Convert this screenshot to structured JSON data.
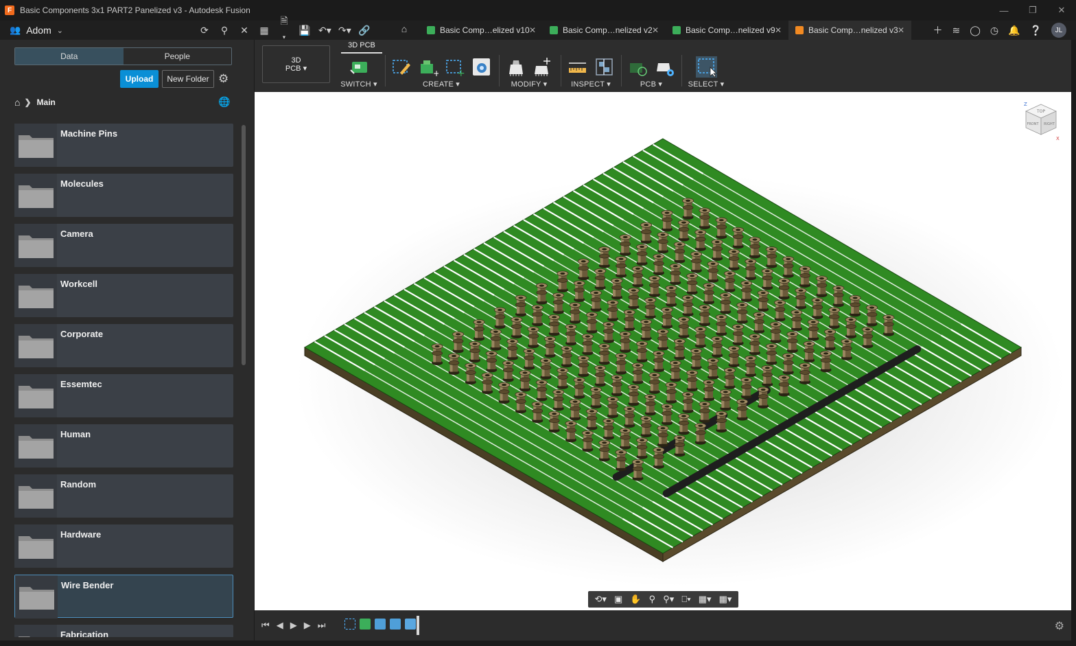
{
  "window": {
    "title": "Basic Components 3x1 PART2 Panelized v3 - Autodesk Fusion",
    "app_logo": "F",
    "controls": {
      "minimize": "—",
      "restore": "❐",
      "close": "✕"
    }
  },
  "topbar": {
    "team_name": "Adom",
    "tabs": [
      {
        "label": "Basic Comp…elized v10",
        "color": "#3cae5a",
        "active": false
      },
      {
        "label": "Basic Comp…nelized v2",
        "color": "#3cae5a",
        "active": false
      },
      {
        "label": "Basic Comp…nelized v9",
        "color": "#3cae5a",
        "active": false
      },
      {
        "label": "Basic Comp…nelized v3",
        "color": "#f28a22",
        "active": true
      }
    ],
    "avatar_initials": "JL"
  },
  "data_panel": {
    "tab_data": "Data",
    "tab_people": "People",
    "upload_label": "Upload",
    "new_folder_label": "New Folder",
    "breadcrumb": "Main",
    "folders": [
      {
        "name": "Machine Pins",
        "selected": false
      },
      {
        "name": "Molecules",
        "selected": false
      },
      {
        "name": "Camera",
        "selected": false
      },
      {
        "name": "Workcell",
        "selected": false
      },
      {
        "name": "Corporate",
        "selected": false
      },
      {
        "name": "Essemtec",
        "selected": false
      },
      {
        "name": "Human",
        "selected": false
      },
      {
        "name": "Random",
        "selected": false
      },
      {
        "name": "Hardware",
        "selected": false
      },
      {
        "name": "Wire Bender",
        "selected": true
      },
      {
        "name": "Fabrication",
        "selected": false
      }
    ]
  },
  "toolbar": {
    "workspace_line1": "3D",
    "workspace_line2": "PCB",
    "workspace_tab": "3D PCB",
    "groups": {
      "switch": "SWITCH",
      "create": "CREATE",
      "modify": "MODIFY",
      "inspect": "INSPECT",
      "pcb": "PCB",
      "select": "SELECT"
    }
  },
  "viewcube": {
    "face_top": "TOP",
    "face_front": "FRONT",
    "face_right": "RIGHT",
    "axis_z": "Z",
    "axis_x": "X"
  },
  "colors": {
    "board_green": "#2f8a22",
    "board_edge": "#5a4a2c",
    "accent_blue": "#0a8fd6",
    "pin_brass": "#7a6a4a"
  }
}
